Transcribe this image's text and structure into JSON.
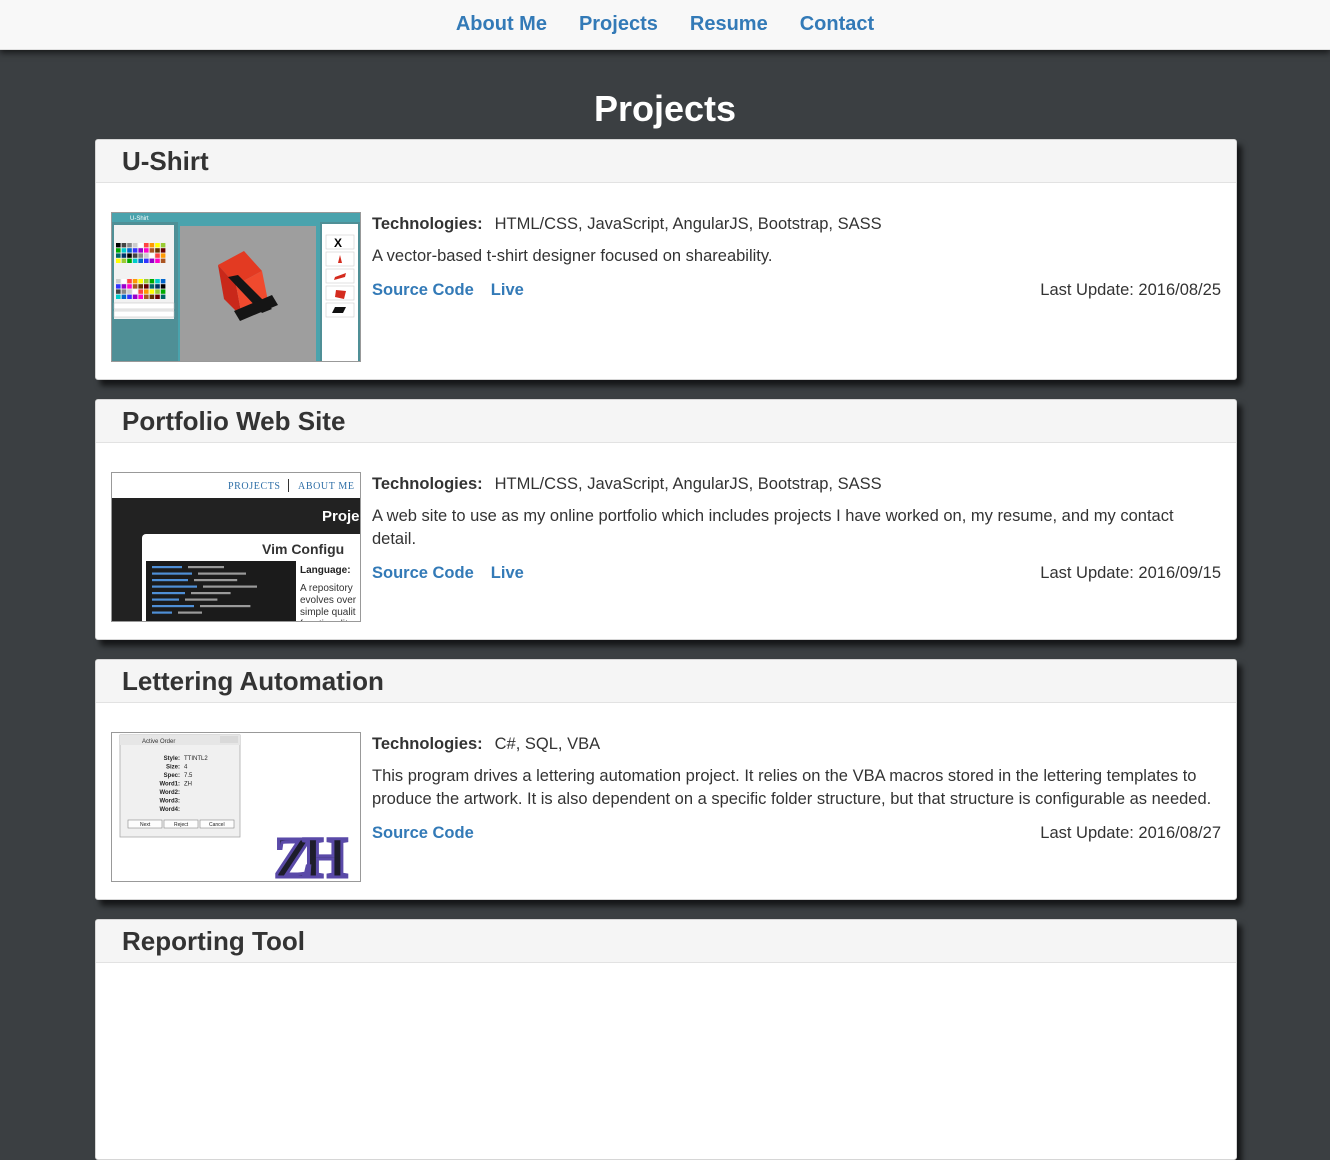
{
  "nav": {
    "items": [
      {
        "label": "About Me"
      },
      {
        "label": "Projects"
      },
      {
        "label": "Resume"
      },
      {
        "label": "Contact"
      }
    ]
  },
  "page": {
    "title": "Projects"
  },
  "projects": [
    {
      "title": "U-Shirt",
      "tech_label": "Technologies:",
      "technologies": "HTML/CSS, JavaScript, AngularJS, Bootstrap, SASS",
      "description": "A vector-based t-shirt designer focused on shareability.",
      "source_label": "Source Code",
      "live_label": "Live",
      "updated": "Last Update: 2016/08/25"
    },
    {
      "title": "Portfolio Web Site",
      "tech_label": "Technologies:",
      "technologies": "HTML/CSS, JavaScript, AngularJS, Bootstrap, SASS",
      "description": "A web site to use as my online portfolio which includes projects I have worked on, my resume, and my contact detail.",
      "source_label": "Source Code",
      "live_label": "Live",
      "updated": "Last Update: 2016/09/15"
    },
    {
      "title": "Lettering Automation",
      "tech_label": "Technologies:",
      "technologies": "C#, SQL, VBA",
      "description": "This program drives a lettering automation project. It relies on the VBA macros stored in the lettering templates to produce the artwork. It is also dependent on a specific folder structure, but that structure is configurable as needed.",
      "source_label": "Source Code",
      "updated": "Last Update: 2016/08/27"
    },
    {
      "title": "Reporting Tool"
    }
  ],
  "thumbs": {
    "ushirt": {
      "app_title": "U-Shirt"
    },
    "portfolio": {
      "nav_projects": "PROJECTS",
      "nav_about": "ABOUT ME",
      "heading": "Proje",
      "card_title": "Vim Configu",
      "language_label": "Language:",
      "blurb": [
        "A repository",
        "evolves over",
        "simple qualit",
        "functionality"
      ]
    },
    "lettering": {
      "window_title": "Active Order",
      "fields": [
        [
          "Style:",
          "TTINTL2"
        ],
        [
          "Size:",
          "4"
        ],
        [
          "Spec:",
          "7.5"
        ],
        [
          "Word1:",
          "ZH"
        ],
        [
          "Word2:",
          ""
        ],
        [
          "Word3:",
          ""
        ],
        [
          "Word4:",
          ""
        ]
      ],
      "buttons": [
        "Next",
        "Reject",
        "Cancel"
      ],
      "logo_text": "ZH"
    }
  },
  "colors": {
    "accent": "#337ab7",
    "background": "#3b3f42",
    "teal": "#4aa3ad"
  }
}
